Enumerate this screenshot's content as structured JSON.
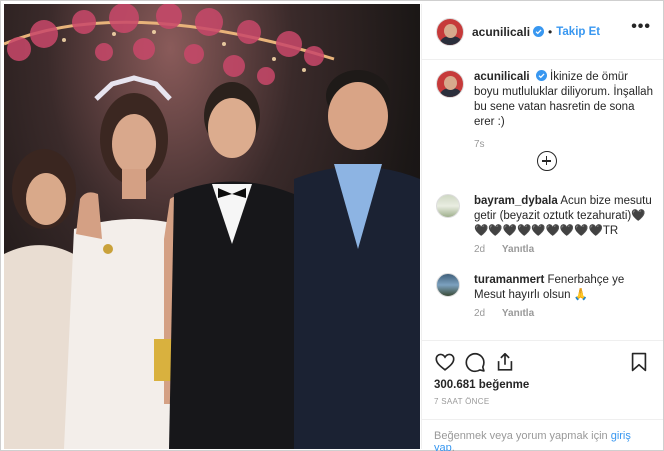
{
  "post": {
    "username": "acunilicali",
    "dot": "•",
    "follow_label": "Takip Et",
    "more_label": "•••",
    "caption_text": "İkinize de ömür boyu mutluluklar diliyorum. İnşallah bu sene vatan hasretin de sona erer :)",
    "caption_age": "7s"
  },
  "comments": [
    {
      "username": "bayram_dybala",
      "text": "Acun bize mesutu getir (beyazit oztutk tezahurati)🖤🖤🖤🖤🖤🖤🖤🖤🖤🖤TR",
      "age": "2d",
      "reply_label": "Yanıtla"
    },
    {
      "username": "turamanmert",
      "text": "Fenerbahçe ye Mesut hayırlı olsun 🙏",
      "age": "2d",
      "reply_label": "Yanıtla"
    }
  ],
  "actions": {
    "likes_count": "300.681",
    "likes_label": "beğenme",
    "time_ago": "7 SAAT ÖNCE"
  },
  "footer": {
    "prompt": "Beğenmek veya yorum yapmak için",
    "login_link": "giriş yap",
    "end": "."
  },
  "icons": {
    "verified": "verified-badge-icon",
    "more": "more-options-icon",
    "load_more": "plus-circle-icon",
    "like": "heart-icon",
    "comment": "comment-bubble-icon",
    "share": "share-icon",
    "save": "bookmark-icon"
  },
  "colors": {
    "link_blue": "#3897f0",
    "text": "#262626",
    "muted": "#999999"
  }
}
